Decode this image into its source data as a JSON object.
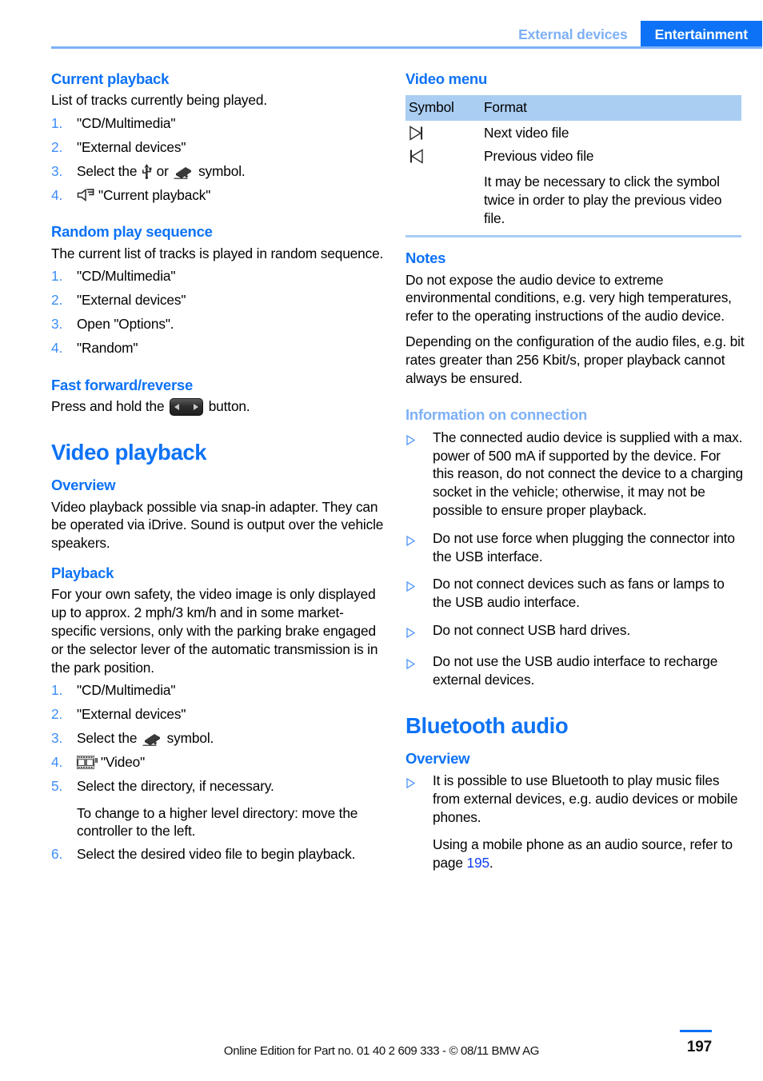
{
  "header": {
    "left_label": "External devices",
    "right_label": "Entertainment",
    "accent_color": "#0d72f5",
    "accent_light_color": "#7eb0f5"
  },
  "left_column": {
    "current_playback": {
      "heading": "Current playback",
      "intro": "List of tracks currently being played.",
      "steps": [
        {
          "num": "1.",
          "text": "\"CD/Multimedia\""
        },
        {
          "num": "2.",
          "text": "\"External devices\""
        },
        {
          "num": "3.",
          "text_before": "Select the",
          "text_mid": "or",
          "text_after": "symbol."
        },
        {
          "num": "4.",
          "text": "\"Current playback\""
        }
      ]
    },
    "random_play": {
      "heading": "Random play sequence",
      "intro": "The current list of tracks is played in random sequence.",
      "steps": [
        {
          "num": "1.",
          "text": "\"CD/Multimedia\""
        },
        {
          "num": "2.",
          "text": "\"External devices\""
        },
        {
          "num": "3.",
          "text": "Open \"Options\"."
        },
        {
          "num": "4.",
          "text": "\"Random\""
        }
      ]
    },
    "fast_forward": {
      "heading": "Fast forward/reverse",
      "text_before": "Press and hold the",
      "text_after": "button."
    },
    "video_playback": {
      "chapter": "Video playback",
      "overview_heading": "Overview",
      "overview_text": "Video playback possible via snap-in adapter. They can be operated via iDrive. Sound is output over the vehicle speakers.",
      "playback_heading": "Playback",
      "playback_text": "For your own safety, the video image is only displayed up to approx. 2 mph/3 km/h and in some market-specific versions, only with the parking brake engaged or the selector lever of the automatic transmission is in the park position.",
      "steps": [
        {
          "num": "1.",
          "text": "\"CD/Multimedia\""
        },
        {
          "num": "2.",
          "text": "\"External devices\""
        },
        {
          "num": "3.",
          "text_before": "Select the",
          "text_after": "symbol."
        },
        {
          "num": "4.",
          "text": "\"Video\""
        },
        {
          "num": "5.",
          "text": "Select the directory, if necessary.",
          "sub": "To change to a higher level directory: move the controller to the left."
        },
        {
          "num": "6.",
          "text": "Select the desired video file to begin playback."
        }
      ]
    }
  },
  "right_column": {
    "video_menu": {
      "heading": "Video menu",
      "columns": [
        "Symbol",
        "Format"
      ],
      "rows": [
        {
          "symbol": "next-track-icon",
          "format": "Next video file",
          "note": ""
        },
        {
          "symbol": "previous-track-icon",
          "format": "Previous video file",
          "note": "It may be necessary to click the symbol twice in order to play the previous video file."
        }
      ]
    },
    "notes": {
      "heading": "Notes",
      "paragraphs": [
        "Do not expose the audio device to extreme environmental conditions, e.g. very high temperatures, refer to the operating instructions of the audio device.",
        "Depending on the configuration of the audio files, e.g. bit rates greater than 256 Kbit/s, proper playback cannot always be ensured."
      ]
    },
    "information_on_connection": {
      "heading": "Information on connection",
      "bullets": [
        "The connected audio device is supplied with a max. power of 500 mA if supported by the device. For this reason, do not connect the device to a charging socket in the vehicle; otherwise, it may not be possible to ensure proper playback.",
        "Do not use force when plugging the connector into the USB interface.",
        "Do not connect devices such as fans or lamps to the USB audio interface.",
        "Do not connect USB hard drives.",
        "Do not use the USB audio interface to recharge external devices."
      ]
    },
    "bluetooth_audio": {
      "chapter": "Bluetooth audio",
      "overview_heading": "Overview",
      "bullet": "It is possible to use Bluetooth to play music files from external devices, e.g. audio devices or mobile phones.",
      "sub_before": "Using a mobile phone as an audio source, refer to page",
      "sub_page": "195",
      "sub_after": "."
    }
  },
  "footer": {
    "text": "Online Edition for Part no. 01 40 2 609 333 - © 08/11 BMW AG",
    "page_number": "197"
  }
}
